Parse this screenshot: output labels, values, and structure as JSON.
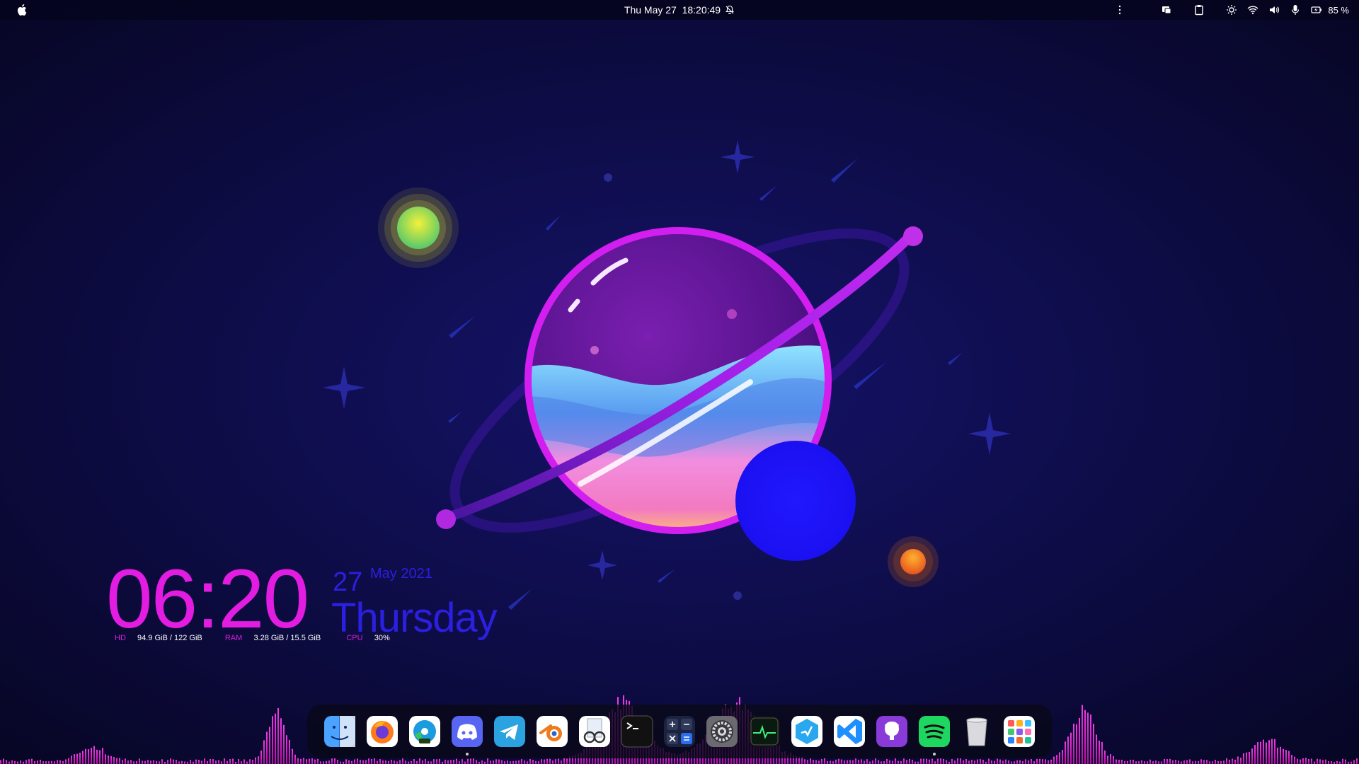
{
  "menubar": {
    "datetime": "Thu May 27  18:20:49",
    "battery": "85 %"
  },
  "widget": {
    "time": "06:20",
    "day": "27",
    "month_year": "May 2021",
    "weekday": "Thursday",
    "hd_label": "HD",
    "hd_value": "94.9 GiB / 122 GiB",
    "ram_label": "RAM",
    "ram_value": "3.28 GiB / 15.5 GiB",
    "cpu_label": "CPU",
    "cpu_value": "30%"
  },
  "colors": {
    "clock": "#e21ce0",
    "date": "#2b1fe0",
    "background": "#0b0a3a",
    "visualizer": "#e51fd8"
  },
  "dock": [
    {
      "name": "finder",
      "icon": "finder-icon",
      "running": false
    },
    {
      "name": "firefox",
      "icon": "firefox-icon",
      "running": false
    },
    {
      "name": "edge-dev",
      "icon": "edge-dev-icon",
      "running": false
    },
    {
      "name": "discord",
      "icon": "discord-icon",
      "running": true
    },
    {
      "name": "telegram",
      "icon": "telegram-icon",
      "running": false
    },
    {
      "name": "blender",
      "icon": "blender-icon",
      "running": false
    },
    {
      "name": "document-viewer",
      "icon": "document-viewer-icon",
      "running": false
    },
    {
      "name": "terminal",
      "icon": "terminal-icon",
      "running": false
    },
    {
      "name": "calculator",
      "icon": "calculator-icon",
      "running": false
    },
    {
      "name": "system-settings",
      "icon": "settings-gear-icon",
      "running": false
    },
    {
      "name": "system-monitor",
      "icon": "activity-monitor-icon",
      "running": false
    },
    {
      "name": "app-store",
      "icon": "hexagon-app-icon",
      "running": false
    },
    {
      "name": "vscode",
      "icon": "vscode-icon",
      "running": false
    },
    {
      "name": "github-desktop",
      "icon": "github-icon",
      "running": false
    },
    {
      "name": "spotify",
      "icon": "spotify-icon",
      "running": true
    },
    {
      "name": "trash",
      "icon": "trash-icon",
      "running": false
    },
    {
      "name": "app-grid",
      "icon": "app-grid-icon",
      "running": false
    }
  ]
}
